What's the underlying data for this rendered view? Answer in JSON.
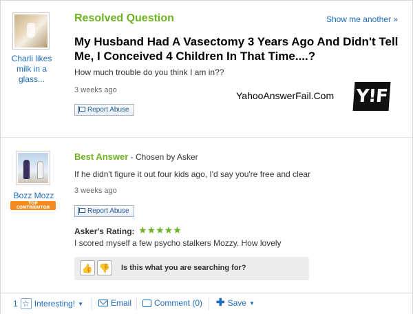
{
  "question": {
    "status_label": "Resolved Question",
    "show_another": "Show me another »",
    "asker_name": "Charli likes milk in a glass...",
    "title": "My Husband Had A Vasectomy 3 Years Ago And Didn't Tell Me, I Conceived 4 Children In That Time....?",
    "detail": "How much trouble do you think I am in??",
    "time": "3 weeks ago",
    "report_label": "Report Abuse"
  },
  "watermark": {
    "site": "YahooAnswerFail.Com",
    "logo_text": "Y!F"
  },
  "answer": {
    "heading": "Best Answer",
    "chosen_by": " - Chosen by Asker",
    "answerer_name": "Bozz Mozz",
    "badge_line1": "TOP",
    "badge_line2": "CONTRIBUTOR",
    "text": "If he didn't figure it out four kids ago, I'd say you're free and clear",
    "time": "3 weeks ago",
    "report_label": "Report Abuse",
    "rating_label": "Asker's Rating:",
    "rating_stars": "★★★★★",
    "rating_value": 5,
    "rating_comment": "I scored myself a few psycho stalkers Mozzy. How lovely"
  },
  "search_prompt": {
    "thumb_up": "👍",
    "thumb_down": "👎",
    "question": "Is this what you are searching for?"
  },
  "bottom_bar": {
    "interesting_count": "1",
    "interesting_label": "Interesting!",
    "email_label": "Email",
    "comment_label": "Comment (0)",
    "save_label": "Save"
  },
  "colors": {
    "accent_green": "#6db321",
    "link_blue": "#1d6bbf",
    "badge_orange": "#f58b1f"
  }
}
